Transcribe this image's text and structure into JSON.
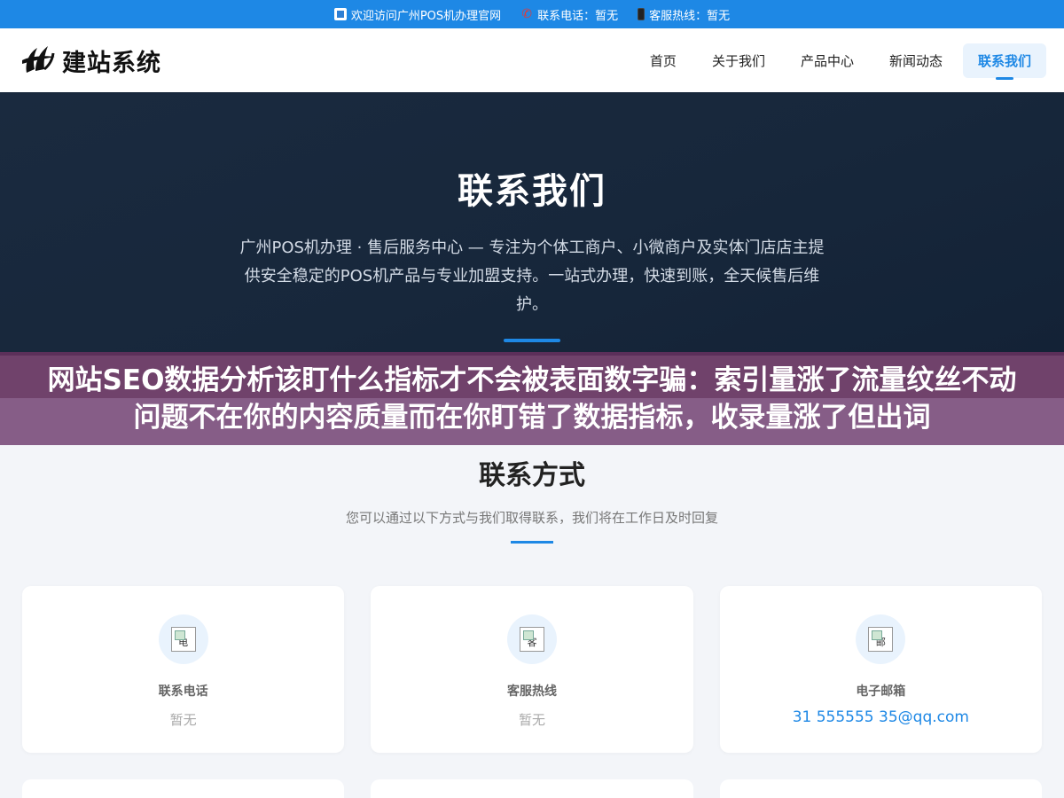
{
  "topbar": {
    "welcome": "欢迎访问广州POS机办理官网",
    "phone": "联系电话：暂无",
    "hotline": "客服热线：暂无"
  },
  "header": {
    "logo_text": "建站系统",
    "nav": [
      {
        "label": "首页"
      },
      {
        "label": "关于我们"
      },
      {
        "label": "产品中心"
      },
      {
        "label": "新闻动态"
      },
      {
        "label": "联系我们"
      }
    ],
    "active_index": 4
  },
  "hero": {
    "title": "联系我们",
    "description": "广州POS机办理 · 售后服务中心 — 专注为个体工商户、小微商户及实体门店店主提供安全稳定的POS机产品与专业加盟支持。一站式办理，快速到账，全天候售后维护。"
  },
  "banner": {
    "text": "网站SEO数据分析该盯什么指标才不会被表面数字骗：索引量涨了流量纹丝不动问题不在你的内容质量而在你盯错了数据指标，收录量涨了但出词"
  },
  "contact": {
    "title": "联系方式",
    "subtitle": "您可以通过以下方式与我们取得联系，我们将在工作日及时回复",
    "cards": [
      {
        "icon_alt": "电",
        "label": "联系电话",
        "value": "暂无"
      },
      {
        "icon_alt": "客",
        "label": "客服热线",
        "value": "暂无"
      },
      {
        "icon_alt": "邮",
        "label": "电子邮箱",
        "value": "31 555555 35@qq.com"
      }
    ]
  },
  "colors": {
    "accent": "#1e88e5",
    "hero_bg": "#17273b",
    "banner_bg": "#6e3c6e",
    "page_bg": "#f3f5f9"
  }
}
